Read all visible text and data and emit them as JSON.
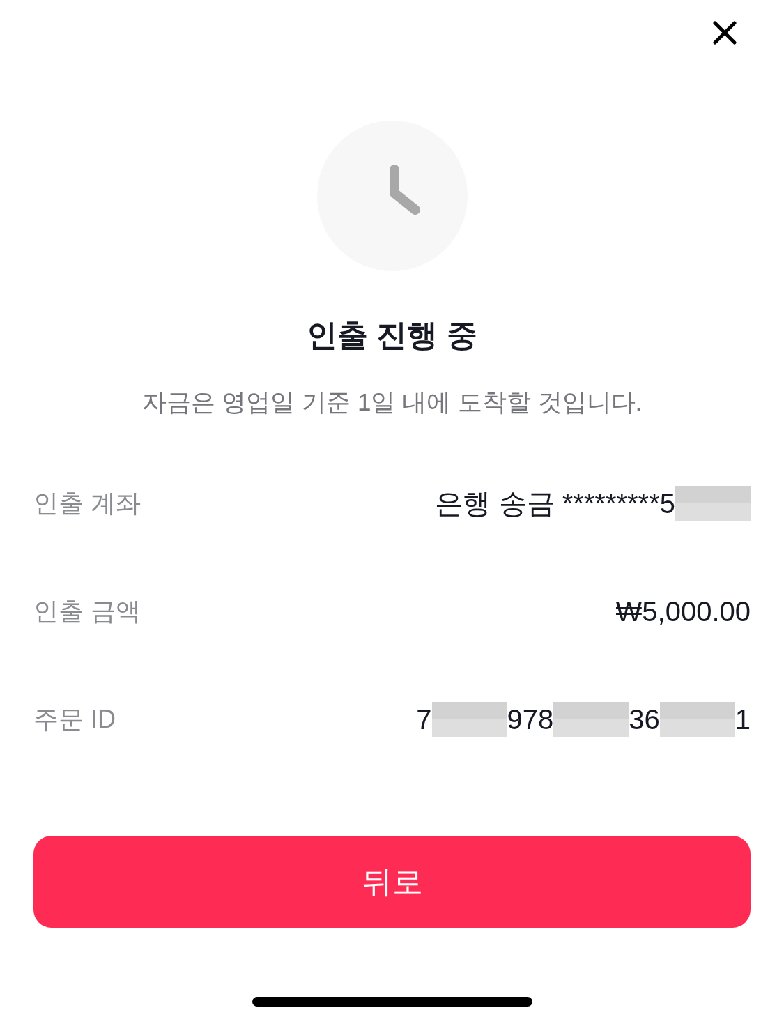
{
  "status": {
    "title": "인출 진행 중",
    "message": "자금은 영업일 기준 1일 내에 도착할 것입니다."
  },
  "details": [
    {
      "label": "인출 계좌",
      "value": [
        {
          "kind": "text",
          "text": "은행 송금 *********5"
        },
        {
          "kind": "redacted"
        }
      ]
    },
    {
      "label": "인출 금액",
      "value": [
        {
          "kind": "text",
          "text": "₩5,000.00"
        }
      ]
    },
    {
      "label": "주문 ID",
      "value": [
        {
          "kind": "text",
          "text": "7"
        },
        {
          "kind": "redacted"
        },
        {
          "kind": "text",
          "text": "978"
        },
        {
          "kind": "redacted"
        },
        {
          "kind": "text",
          "text": "36"
        },
        {
          "kind": "redacted"
        },
        {
          "kind": "text",
          "text": "1"
        }
      ]
    }
  ],
  "buttons": [
    {
      "label": "뒤로"
    }
  ]
}
